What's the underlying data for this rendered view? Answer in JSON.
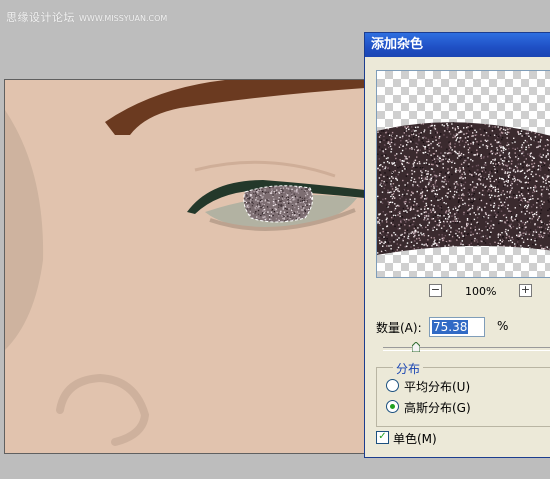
{
  "watermark": {
    "site": "思缘设计论坛",
    "url": "WWW.MISSYUAN.COM"
  },
  "dialog": {
    "title": "添加杂色",
    "zoom": {
      "minus": "−",
      "value": "100%",
      "plus": "+"
    },
    "amount": {
      "label": "数量(A):",
      "value": "75.38",
      "unit": "%",
      "slider_fraction": 0.19
    },
    "distribution": {
      "title": "分布",
      "options": [
        {
          "label": "平均分布(U)",
          "selected": false
        },
        {
          "label": "高斯分布(G)",
          "selected": true
        }
      ]
    },
    "monochrome": {
      "label": "单色(M)",
      "checked": true,
      "mark": "✓"
    }
  },
  "colors": {
    "titlebar": "#1f4fc4",
    "skin": "#e1c3ae",
    "eyeliner": "#23382a",
    "hair": "#6b3a20"
  }
}
